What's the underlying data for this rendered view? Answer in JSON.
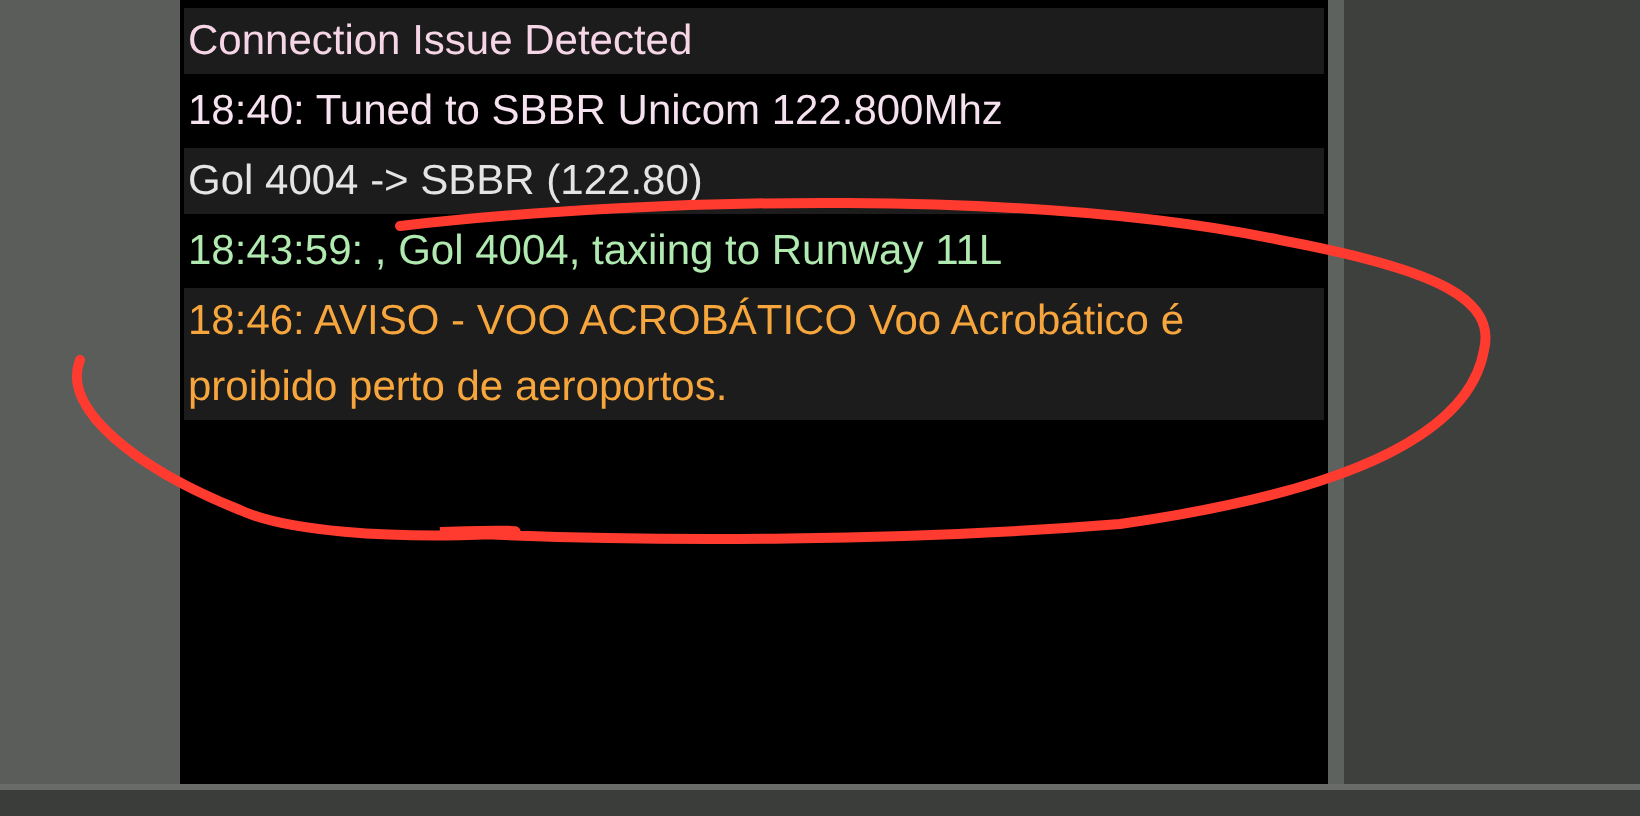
{
  "chat_log": {
    "messages": [
      {
        "text": "Connection Issue Detected",
        "color": "#f6d6e6"
      },
      {
        "text": "18:40: Tuned to SBBR Unicom 122.800Mhz",
        "color": "#f6e2ee"
      },
      {
        "text": "Gol 4004 -> SBBR (122.80)",
        "color": "#e4e4e4"
      },
      {
        "text": "18:43:59: , Gol 4004, taxiing to Runway 11L",
        "color": "#b0eab0"
      },
      {
        "text": "18:46: AVISO - VOO ACROBÁTICO Voo Acrobático é proibido perto de aeroportos.",
        "color": "#f6a63c"
      }
    ]
  }
}
